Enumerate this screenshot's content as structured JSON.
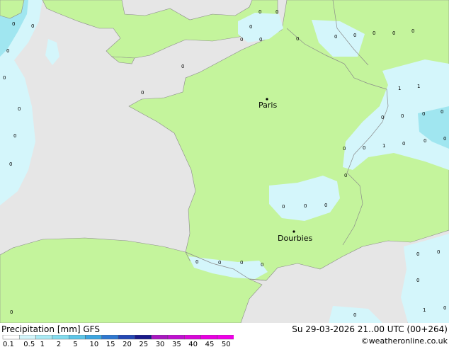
{
  "map": {
    "colors": {
      "sea": "#e6e6e6",
      "land": "#c4f49c",
      "precip_light": "#d4f6fb",
      "precip_mid": "#a0e6f0",
      "border": "#8a8a8a",
      "coast": "#8a8a8a"
    },
    "cities": [
      {
        "name": "Paris"
      },
      {
        "name": "Dourbies"
      }
    ],
    "precip_values": [
      "0",
      "0",
      "0",
      "0",
      "0",
      "0",
      "0",
      "0",
      "0",
      "0",
      "0",
      "0",
      "0",
      "0",
      "0",
      "0",
      "0",
      "0",
      "0",
      "0",
      "1",
      "1",
      "0",
      "0",
      "0",
      "0",
      "0",
      "1",
      "0",
      "0",
      "0",
      "0",
      "0",
      "0",
      "0",
      "0",
      "0",
      "0",
      "0",
      "0",
      "0",
      "0",
      "0",
      "1",
      "0",
      "0",
      "0"
    ]
  },
  "legend": {
    "title": "Precipitation [mm]  GFS",
    "date": "Su 29-03-2026 21..00 UTC (00+264)",
    "credit": "©weatheronline.co.uk",
    "scale": [
      {
        "label": "0.1",
        "color": "#ffffff"
      },
      {
        "label": "0.5",
        "color": "#d4f6fb"
      },
      {
        "label": "1",
        "color": "#aaeaf4"
      },
      {
        "label": "2",
        "color": "#84dcee"
      },
      {
        "label": "5",
        "color": "#5ec6e8"
      },
      {
        "label": "10",
        "color": "#3da6e0"
      },
      {
        "label": "15",
        "color": "#2f78d0"
      },
      {
        "label": "20",
        "color": "#2448b4"
      },
      {
        "label": "25",
        "color": "#1a1a8a"
      },
      {
        "label": "30",
        "color": "#a818c0"
      },
      {
        "label": "35",
        "color": "#c010d0"
      },
      {
        "label": "40",
        "color": "#d808d8"
      },
      {
        "label": "45",
        "color": "#e800e0"
      },
      {
        "label": "50",
        "color": "#f000e8"
      }
    ]
  }
}
